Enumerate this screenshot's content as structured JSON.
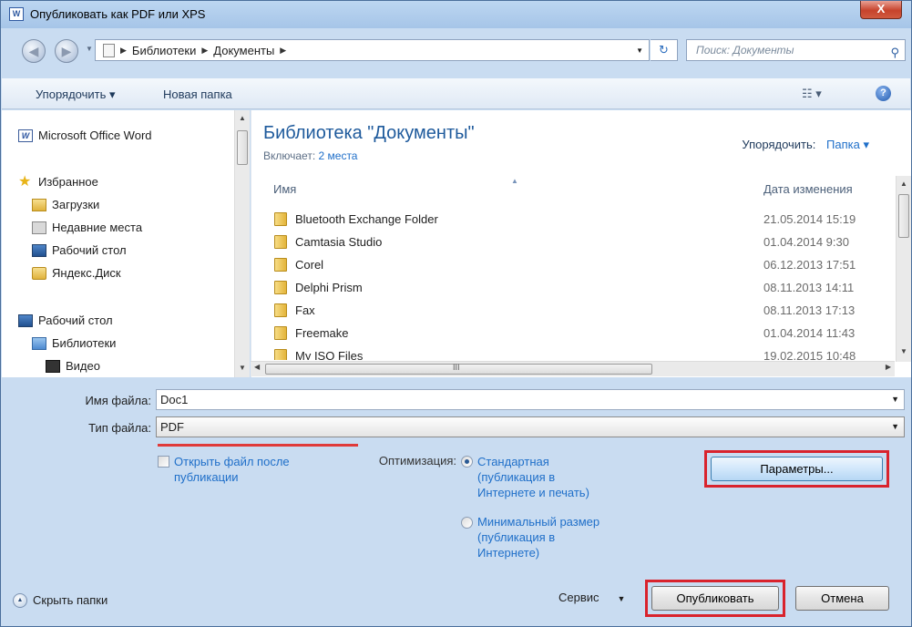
{
  "window": {
    "title": "Опубликовать как PDF или XPS",
    "close_glyph": "X",
    "app_icon": "W"
  },
  "address": {
    "crumbs": [
      "Библиотеки",
      "Документы"
    ],
    "search_placeholder": "Поиск: Документы"
  },
  "toolbar": {
    "organize": "Упорядочить ▾",
    "new_folder": "Новая папка"
  },
  "sidebar": {
    "items": [
      {
        "label": "Microsoft Office Word",
        "icon": "word-icon"
      },
      {
        "label": "Избранное",
        "icon": "star-icon"
      },
      {
        "label": "Загрузки",
        "icon": "downloads-folder-icon"
      },
      {
        "label": "Недавние места",
        "icon": "recent-places-icon"
      },
      {
        "label": "Рабочий стол",
        "icon": "desktop-icon"
      },
      {
        "label": "Яндекс.Диск",
        "icon": "folder-icon"
      },
      {
        "label": "Рабочий стол",
        "icon": "desktop-icon"
      },
      {
        "label": "Библиотеки",
        "icon": "libraries-icon"
      },
      {
        "label": "Видео",
        "icon": "video-icon"
      }
    ]
  },
  "library": {
    "title": "Библиотека \"Документы\"",
    "includes_label": "Включает:",
    "includes_link": "2 места",
    "arrange_label": "Упорядочить:",
    "arrange_value": "Папка ▾"
  },
  "columns": {
    "name": "Имя",
    "date": "Дата изменения"
  },
  "files": [
    {
      "name": "Bluetooth Exchange Folder",
      "date": "21.05.2014 15:19"
    },
    {
      "name": "Camtasia Studio",
      "date": "01.04.2014 9:30"
    },
    {
      "name": "Corel",
      "date": "06.12.2013 17:51"
    },
    {
      "name": "Delphi Prism",
      "date": "08.11.2013 14:11"
    },
    {
      "name": "Fax",
      "date": "08.11.2013 17:13"
    },
    {
      "name": "Freemake",
      "date": "01.04.2014 11:43"
    },
    {
      "name": "My ISO Files",
      "date": "19.02.2015 10:48"
    }
  ],
  "form": {
    "filename_label": "Имя файла:",
    "filename_value": "Doc1",
    "filetype_label": "Тип файла:",
    "filetype_value": "PDF",
    "open_after": "Открыть файл после публикации",
    "optimization_label": "Оптимизация:",
    "opt_standard": "Стандартная (публикация в Интернете и печать)",
    "opt_minimal": "Минимальный размер (публикация в Интернете)",
    "params_button": "Параметры..."
  },
  "footer": {
    "hide_folders": "Скрыть папки",
    "service": "Сервис",
    "publish_button": "Опубликовать",
    "cancel_button": "Отмена"
  }
}
